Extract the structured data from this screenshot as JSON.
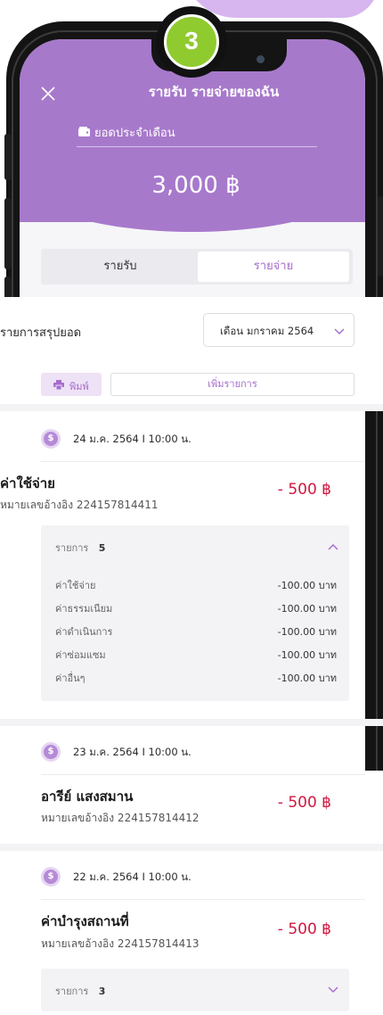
{
  "step_badge": "3",
  "header": {
    "title": "รายรับ รายจ่ายของฉัน",
    "balance_label": "ยอดประจำเดือน",
    "balance_amount": "3,000 ฿"
  },
  "tabs": [
    {
      "label": "รายรับ",
      "active": false
    },
    {
      "label": "รายจ่าย",
      "active": true
    }
  ],
  "summary": {
    "label": "รายการสรุปยอด",
    "month_selected": "เดือน มกราคม 2564"
  },
  "actions": {
    "print_label": "พิมพ์",
    "add_label": "เพิ่มรายการ"
  },
  "transactions": [
    {
      "date": "24 ม.ค. 2564  I  10:00 น.",
      "title": "ค่าใช้จ่าย",
      "ref": "หมายเลขอ้างอิง  224157814411",
      "amount": "- 500 ฿",
      "details_label": "รายการ",
      "details_count": "5",
      "expanded": true,
      "items": [
        {
          "label": "ค่าใช้จ่าย",
          "value": "-100.00 บาท"
        },
        {
          "label": "ค่าธรรมเนียม",
          "value": "-100.00 บาท"
        },
        {
          "label": "ค่าดำเนินการ",
          "value": "-100.00 บาท"
        },
        {
          "label": "ค่าซ่อมแซม",
          "value": "-100.00 บาท"
        },
        {
          "label": "ค่าอื่นๆ",
          "value": "-100.00 บาท"
        }
      ]
    },
    {
      "date": "23 ม.ค. 2564  I  10:00 น.",
      "title": "อารีย์  แสงสมาน",
      "ref": "หมายเลขอ้างอิง  224157814412",
      "amount": "- 500 ฿"
    },
    {
      "date": "22 ม.ค. 2564  I  10:00 น.",
      "title": "ค่าบำรุงสถานที่",
      "ref": "หมายเลขอ้างอิง  224157814413",
      "amount": "- 500 ฿",
      "details_label": "รายการ",
      "details_count": "3",
      "expanded": false
    }
  ],
  "colors": {
    "header_purple": "#a779cb",
    "accent_purple": "#a56ccc",
    "amount_red": "#d0183f",
    "badge_green": "#8fcb2f"
  }
}
